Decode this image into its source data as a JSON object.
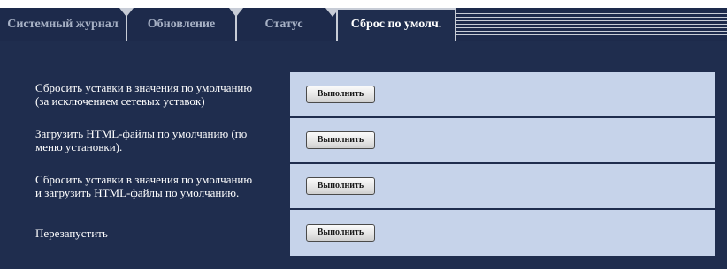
{
  "tabs": [
    {
      "label": "Системный журнал",
      "active": false
    },
    {
      "label": "Обновление",
      "active": false
    },
    {
      "label": "Статус",
      "active": false
    },
    {
      "label": "Сброс по умолч.",
      "active": true
    }
  ],
  "rows": [
    {
      "label": "Сбросить уставки в значения по умолчанию\n(за исключением сетевых уставок)",
      "button": "Выполнить"
    },
    {
      "label": "Загрузить HTML-файлы по умолчанию (по\nменю установки).",
      "button": "Выполнить"
    },
    {
      "label": "Сбросить уставки в значения по умолчанию\nи загрузить HTML-файлы по умолчанию.",
      "button": "Выполнить"
    },
    {
      "label": "Перезапустить",
      "button": "Выполнить"
    }
  ],
  "colors": {
    "navy": "#1f2d4e",
    "panel": "#c6d3ea",
    "inactive_tab_text": "#a7b1c5"
  }
}
